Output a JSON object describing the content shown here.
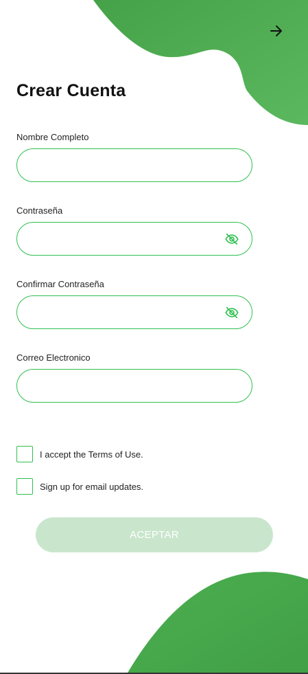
{
  "header": {
    "back_icon": "arrow-right-icon",
    "title": "Crear Cuenta"
  },
  "form": {
    "full_name": {
      "label": "Nombre Completo",
      "value": ""
    },
    "password": {
      "label": "Contraseña",
      "value": "",
      "icon": "eye-off-icon"
    },
    "confirm_password": {
      "label": "Confirmar Contraseña",
      "value": "",
      "icon": "eye-off-icon"
    },
    "email": {
      "label": "Correo Electronico",
      "value": ""
    }
  },
  "checkboxes": {
    "terms": {
      "label": "I accept the Terms of Use.",
      "checked": false
    },
    "updates": {
      "label": "Sign up for email updates.",
      "checked": false
    }
  },
  "actions": {
    "accept_label": "ACEPTAR"
  },
  "colors": {
    "brand_green": "#4caf50",
    "field_border": "#2fbf4f",
    "button_disabled": "#c9e6cd"
  }
}
